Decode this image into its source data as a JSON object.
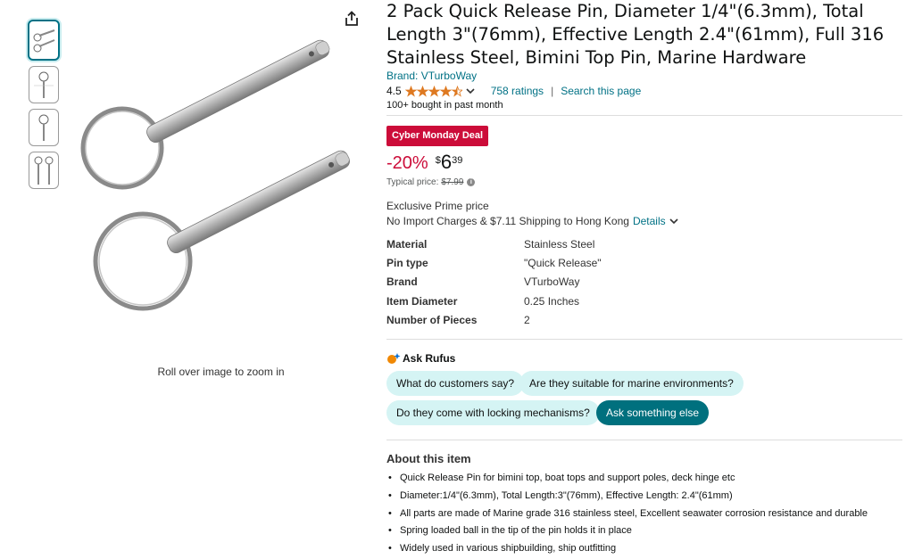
{
  "product": {
    "title": "2 Pack Quick Release Pin, Diameter 1/4\"(6.3mm), Total Length 3\"(76mm), Effective Length 2.4\"(61mm), Full 316 Stainless Steel, Bimini Top Pin, Marine Hardware",
    "brand_link": "Brand: VTurboWay",
    "rating": "4.5",
    "ratings_count": "758 ratings",
    "search_page": "Search this page",
    "separator": "|",
    "bought": "100+ bought in past month"
  },
  "gallery": {
    "zoom_hint": "Roll over image to zoom in"
  },
  "deal": {
    "badge": "Cyber Monday Deal",
    "discount": "-20%",
    "currency": "$",
    "price_whole": "6",
    "price_fraction": "39",
    "typical_label": "Typical price:",
    "typical_price": "$7.99",
    "info_glyph": "i"
  },
  "shipping": {
    "prime": "Exclusive Prime price",
    "charges": "No Import Charges & $7.11 Shipping to Hong Kong",
    "details": "Details"
  },
  "specs": [
    {
      "key": "Material",
      "value": "Stainless Steel"
    },
    {
      "key": "Pin type",
      "value": "\"Quick Release\""
    },
    {
      "key": "Brand",
      "value": "VTurboWay"
    },
    {
      "key": "Item Diameter",
      "value": "0.25 Inches"
    },
    {
      "key": "Number of Pieces",
      "value": "2"
    }
  ],
  "rufus": {
    "title": "Ask Rufus",
    "chips": [
      "What do customers say?",
      "Are they suitable for marine environments?",
      "Do they come with locking mechanisms?",
      "Ask something else"
    ]
  },
  "about": {
    "title": "About this item",
    "bullets": [
      "Quick Release Pin for bimini top, boat tops and support poles, deck hinge etc",
      "Diameter:1/4\"(6.3mm), Total Length:3\"(76mm), Effective Length: 2.4\"(61mm)",
      "All parts are made of Marine grade 316 stainless steel, Excellent seawater corrosion resistance and durable",
      "Spring loaded ball in the tip of the pin holds it in place",
      "Widely used in various shipbuilding, ship outfitting"
    ]
  },
  "colors": {
    "link": "#007185",
    "deal_red": "#cc0c39",
    "star": "#de7921",
    "chip_bg": "#d5f4f4",
    "chip_dark": "#00707e"
  },
  "icons": [
    "share-icon",
    "star-icon",
    "chevron-down-icon",
    "info-icon",
    "rufus-icon"
  ]
}
